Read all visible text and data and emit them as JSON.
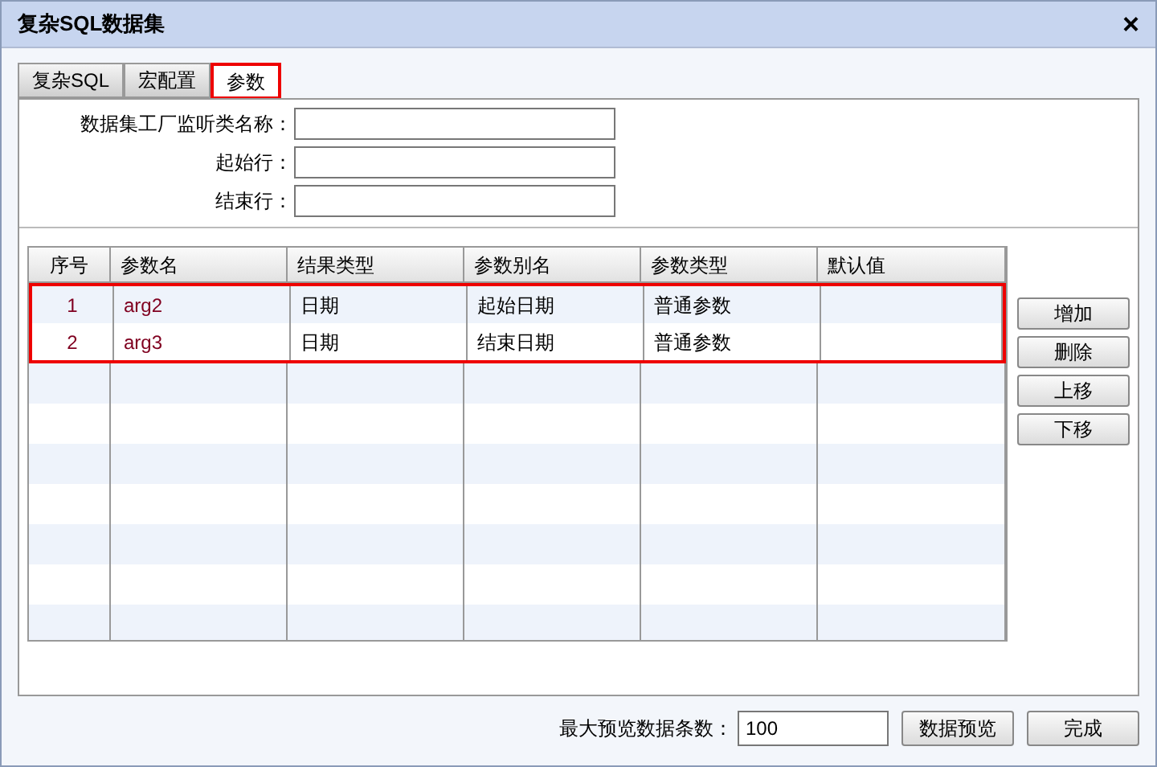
{
  "window": {
    "title": "复杂SQL数据集",
    "close": "×"
  },
  "tabs": [
    {
      "label": "复杂SQL",
      "selected": false
    },
    {
      "label": "宏配置",
      "selected": false
    },
    {
      "label": "参数",
      "selected": true
    }
  ],
  "form": [
    {
      "label": "数据集工厂监听类名称："
    },
    {
      "label": "起始行："
    },
    {
      "label": "结束行："
    }
  ],
  "table": {
    "columns": [
      "序号",
      "参数名",
      "结果类型",
      "参数别名",
      "参数类型",
      "默认值"
    ],
    "rows": [
      {
        "cells": [
          "1",
          "arg2",
          "日期",
          "起始日期",
          "普通参数",
          null
        ],
        "highlighted": true
      },
      {
        "cells": [
          "2",
          "arg3",
          "日期",
          "结束日期",
          "普通参数",
          null
        ],
        "highlighted": true
      }
    ]
  },
  "side_buttons": [
    "增加",
    "删除",
    "上移",
    "下移"
  ],
  "footer": {
    "label": "最大预览数据条数：",
    "value": "100",
    "buttons": [
      "数据预览",
      "完成"
    ]
  }
}
